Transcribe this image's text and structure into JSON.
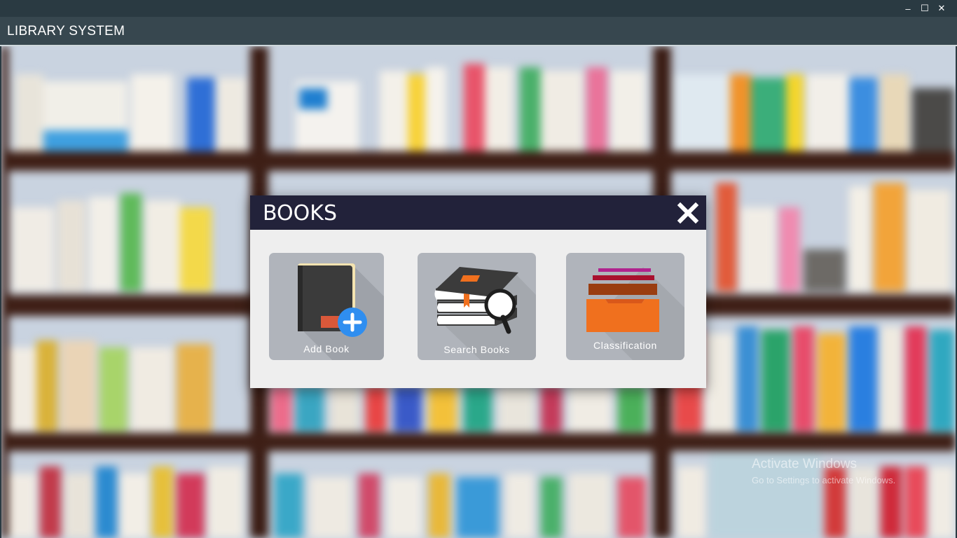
{
  "app": {
    "title": "LIBRARY SYSTEM"
  },
  "window_controls": {
    "minimize": "–",
    "maximize": "☐",
    "close": "✕"
  },
  "dialog": {
    "title": "BOOKS",
    "tiles": [
      {
        "label": "Add Book",
        "icon": "add-book-icon"
      },
      {
        "label": "Search Books",
        "icon": "search-books-icon"
      },
      {
        "label": "Classification",
        "icon": "classification-icon"
      }
    ]
  },
  "watermark": {
    "line1": "Activate Windows",
    "line2": "Go to Settings to activate Windows."
  },
  "colors": {
    "dialog_header": "#22223a",
    "dialog_body": "#eeeeee",
    "tile": "#b0b4bb",
    "accent_blue": "#2f8ef0",
    "accent_orange": "#f0701e"
  }
}
